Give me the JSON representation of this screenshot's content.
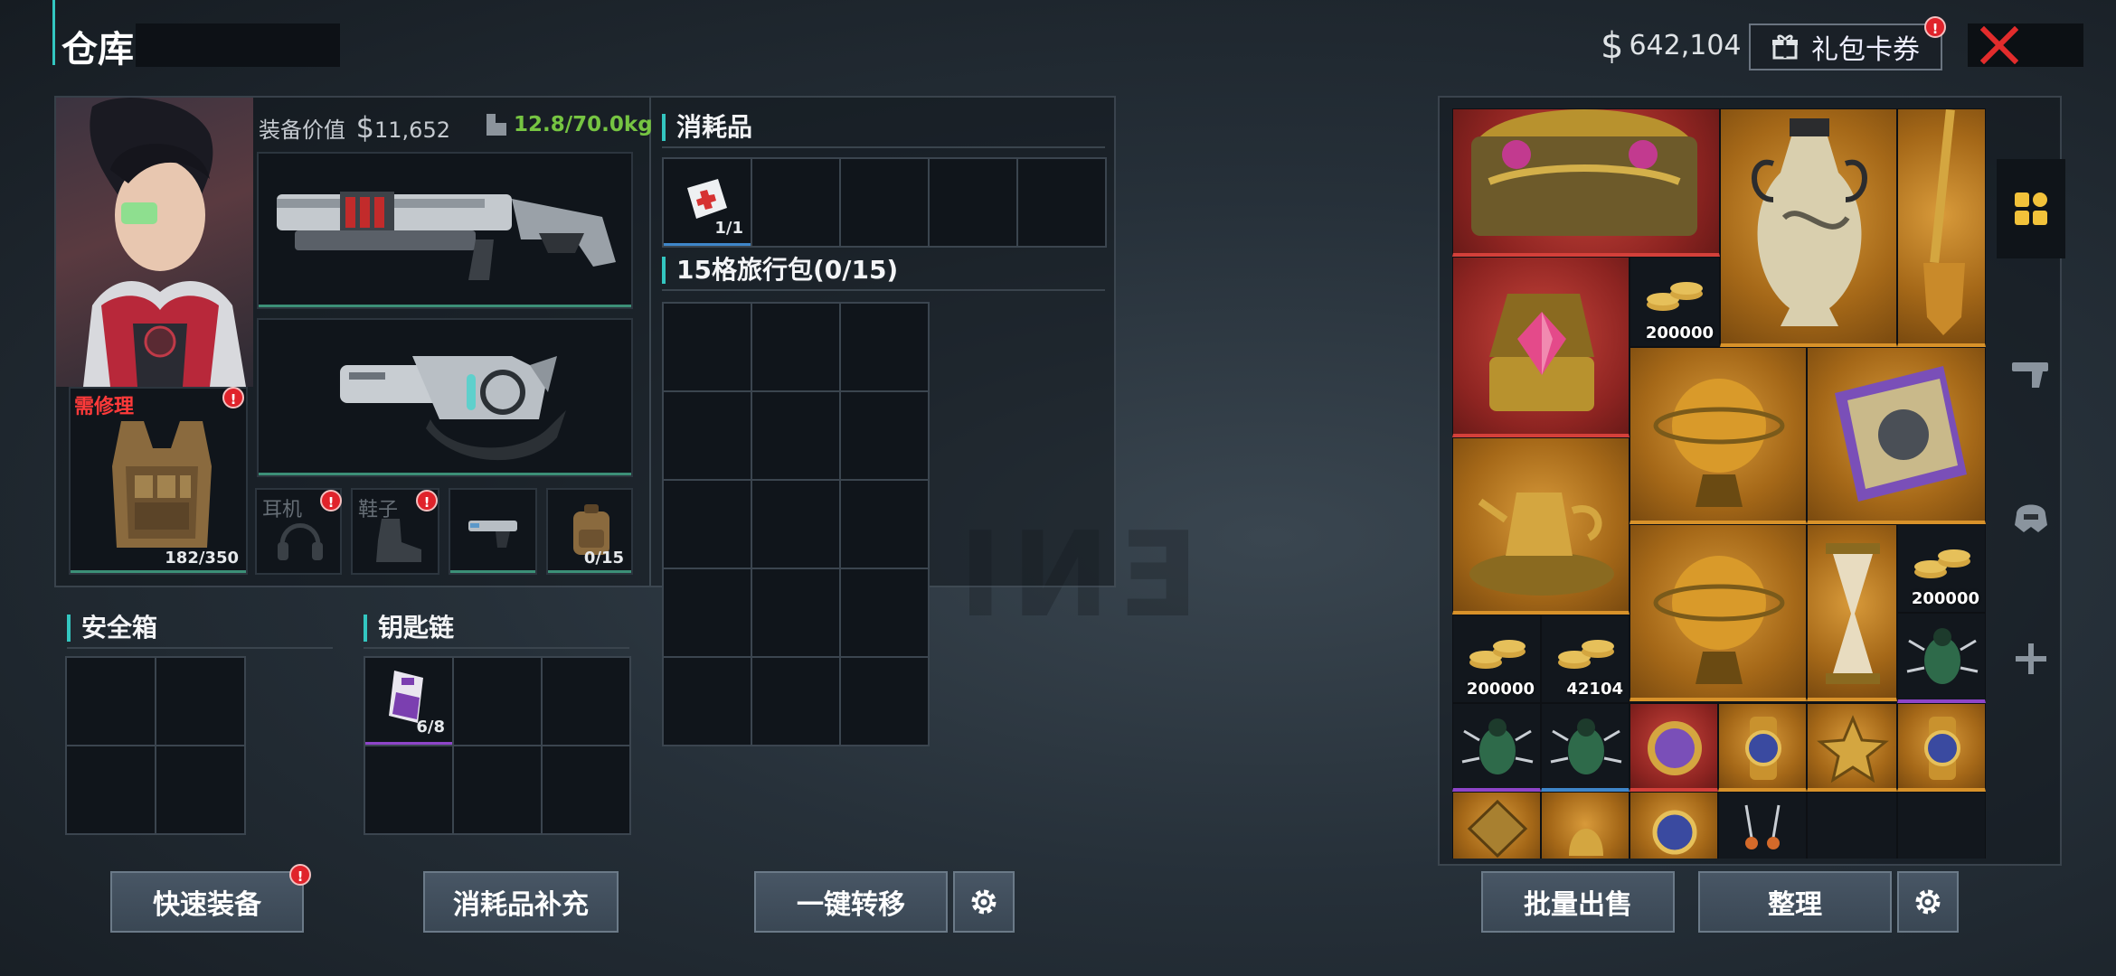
{
  "header": {
    "title": "仓库",
    "money_symbol": "$",
    "money": "642,104",
    "gift_label": "礼包卡券",
    "badge": "!"
  },
  "equipment": {
    "value_label": "装备价值",
    "value_symbol": "$",
    "value": "11,652",
    "weight": "12.8/70.0kg",
    "repair_label": "需修理",
    "armor_durability": "182/350",
    "earphone_label": "耳机",
    "shoes_label": "鞋子",
    "backpack_qty": "0/15"
  },
  "consumables": {
    "title": "消耗品",
    "item_qty": "1/1"
  },
  "travel_bag": {
    "title": "15格旅行包(0/15)"
  },
  "safe_box": {
    "title": "安全箱"
  },
  "keychain": {
    "title": "钥匙链",
    "item_qty": "6/8"
  },
  "buttons": {
    "quick_equip": "快速装备",
    "refill": "消耗品补充",
    "transfer": "一键转移",
    "bulk_sell": "批量出售",
    "sort": "整理"
  },
  "stash": {
    "qty_200000": "200000",
    "qty_42104": "42104"
  },
  "colors": {
    "accent": "#33c6c0",
    "gold": "#d8922a",
    "red": "#c9453c",
    "purple": "#8e45c9"
  },
  "icons": [
    "gift-icon",
    "close-icon",
    "gear-icon",
    "grid-icon",
    "pistol-icon",
    "helmet-icon",
    "plus-icon",
    "weight-icon"
  ]
}
